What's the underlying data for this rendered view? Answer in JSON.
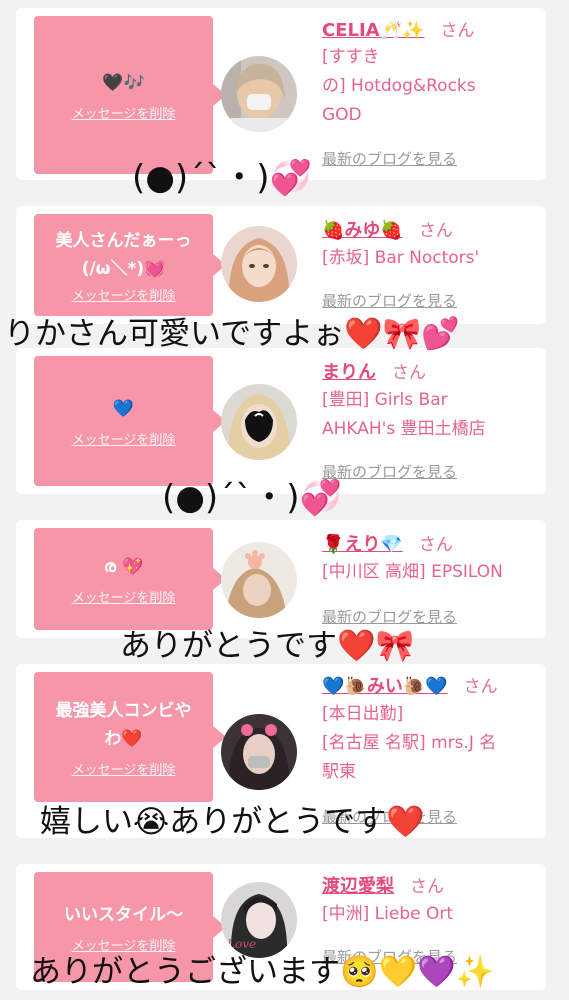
{
  "messages": [
    {
      "text": "🖤🎶",
      "delete_label": "メッセージを削除",
      "name": "CELIA🥂✨",
      "honorific": "さん",
      "shop_lines": [
        "[すすき",
        "の] Hotdog&Rocks",
        "GOD"
      ],
      "blog_link": "最新のブログを見る"
    },
    {
      "text_lines": [
        "美人さんだぁーっ",
        "(/ω＼*)💓"
      ],
      "delete_label": "メッセージを削除",
      "name": "🍓みゆ🍓",
      "honorific": "さん",
      "shop_lines": [
        "[赤坂] Bar Noctors'"
      ],
      "blog_link": "最新のブログを見る"
    },
    {
      "text": "💙",
      "delete_label": "メッセージを削除",
      "name": "まりん",
      "honorific": "さん",
      "shop_lines": [
        "[豊田] Girls Bar",
        "AHKAH's 豊田土橋店"
      ],
      "blog_link": "最新のブログを見る"
    },
    {
      "text": "ര 💖",
      "delete_label": "メッセージを削除",
      "name": "🌹えり💎",
      "honorific": "さん",
      "shop_lines": [
        "[中川区 高畑] EPSILON"
      ],
      "blog_link": "最新のブログを見る"
    },
    {
      "text_lines": [
        "最強美人コンビや",
        "わ❤️"
      ],
      "delete_label": "メッセージを削除",
      "name": "💙🐌みい🐌💙",
      "honorific": "さん",
      "shop_lines": [
        "[本日出勤]",
        "[名古屋 名駅] mrs.J 名",
        "駅東"
      ],
      "blog_link": "最新のブログを見る"
    },
    {
      "text": "いいスタイル〜",
      "delete_label": "メッセージを削除",
      "name": "渡辺愛梨",
      "honorific": "さん",
      "shop_lines": [
        "[中洲] Liebe Ort"
      ],
      "blog_link": "最新のブログを見る"
    }
  ],
  "overlays": [
    "(●)´`・)💞",
    "りかさん可愛いですよぉ❤️🎀💕",
    "(●)´`・)💞",
    "ありがとうです❤️🎀",
    "嬉しい😭ありがとうです❤️",
    "ありがとうございます🥺💛💜✨"
  ],
  "colors": {
    "bubble": "#f796a8",
    "name": "#e64a7a",
    "shop": "#e8638b",
    "background": "#f2f2f3"
  }
}
